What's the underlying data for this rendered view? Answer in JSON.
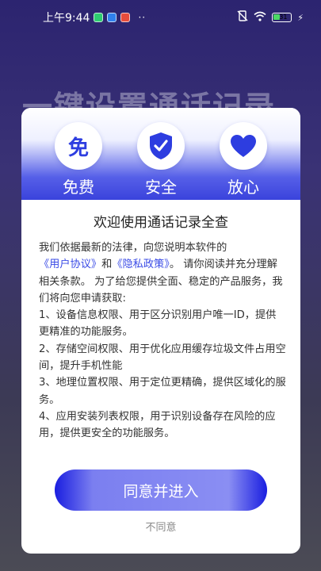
{
  "status_bar": {
    "time": "上午9:44",
    "more": "··",
    "battery_level": "31",
    "colors": {
      "app1": "#2ecc71",
      "app2": "#2f80ed",
      "app3": "#e74c3c"
    }
  },
  "background": {
    "title": "一键设置通话记录"
  },
  "dialog": {
    "features": [
      {
        "label": "免费",
        "icon": "free-icon",
        "glyph": "免"
      },
      {
        "label": "安全",
        "icon": "shield-check-icon"
      },
      {
        "label": "放心",
        "icon": "heart-icon"
      }
    ],
    "title": "欢迎使用通话记录全查",
    "body": {
      "intro_1": "我们依据最新的法律，向您说明本软件的",
      "user_agreement": "《用户协议》",
      "and": "和",
      "privacy_policy": "《隐私政策》",
      "intro_2": "。 请你阅读并充分理解相关条款。 为了给您提供全面、稳定的产品服务，我们将向您申请获取:",
      "items": [
        "1、设备信息权限、用于区分识别用户唯一ID，提供更精准的功能服务。",
        "2、存储空间权限、用于优化应用缓存垃圾文件占用空间，提升手机性能",
        "3、地理位置权限、用于定位更精确，提供区域化的服务。",
        "4、应用安装列表权限，用于识别设备存在风险的应用，提供更安全的功能服务。"
      ]
    },
    "agree_label": "同意并进入",
    "disagree_label": "不同意"
  },
  "colors": {
    "accent": "#3a43dc",
    "link": "#3a4be6"
  }
}
